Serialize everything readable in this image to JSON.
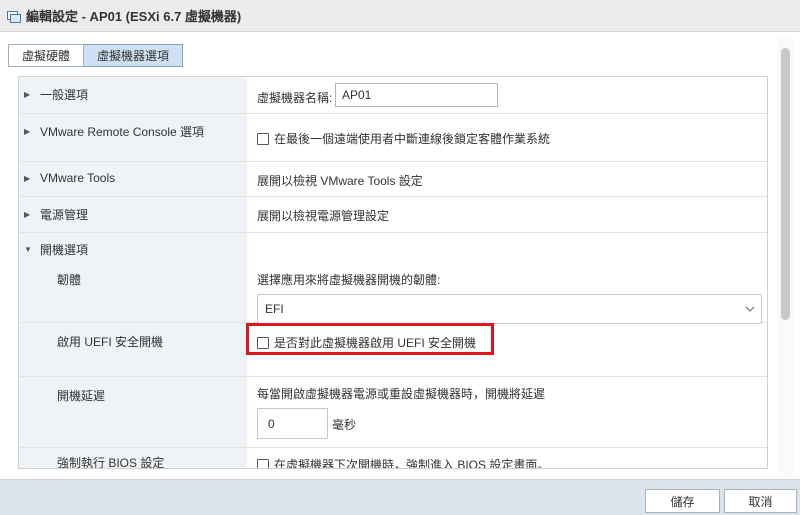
{
  "window": {
    "title": "編輯設定 - AP01 (ESXi 6.7 虛擬機器)"
  },
  "tabs": [
    {
      "label": "虛擬硬體",
      "active": false
    },
    {
      "label": "虛擬機器選項",
      "active": true
    }
  ],
  "settings": {
    "general": {
      "label": "一般選項",
      "vm_name_label": "虛擬機器名稱:",
      "vm_name_value": "AP01"
    },
    "remote_console": {
      "label": "VMware Remote Console 選項",
      "checkbox_label": "在最後一個遠端使用者中斷連線後鎖定客體作業系統",
      "checked": false
    },
    "vmware_tools": {
      "label": "VMware Tools",
      "text": "展開以檢視 VMware Tools 設定"
    },
    "power": {
      "label": "電源管理",
      "text": "展開以檢視電源管理設定"
    },
    "boot": {
      "label": "開機選項",
      "firmware": {
        "label": "韌體",
        "description": "選擇應用來將虛擬機器開機的韌體:",
        "selected": "EFI"
      },
      "secure_boot": {
        "label": "啟用 UEFI 安全開機",
        "checkbox_label": "是否對此虛擬機器啟用 UEFI 安全開機",
        "checked": false
      },
      "boot_delay": {
        "label": "開機延遲",
        "description": "每當開啟虛擬機器電源或重設虛擬機器時，開機將延遲",
        "value": "0",
        "unit": "毫秒"
      },
      "force_bios": {
        "label": "強制執行 BIOS 設定",
        "checkbox_label": "在虛擬機器下次開機時，強制進入 BIOS 設定畫面。",
        "checked": false
      }
    }
  },
  "footer": {
    "save_label": "儲存",
    "cancel_label": "取消"
  },
  "colors": {
    "highlight": "#e0161d",
    "active_tab": "#cfe0f3",
    "label_column": "#eef3f8"
  }
}
